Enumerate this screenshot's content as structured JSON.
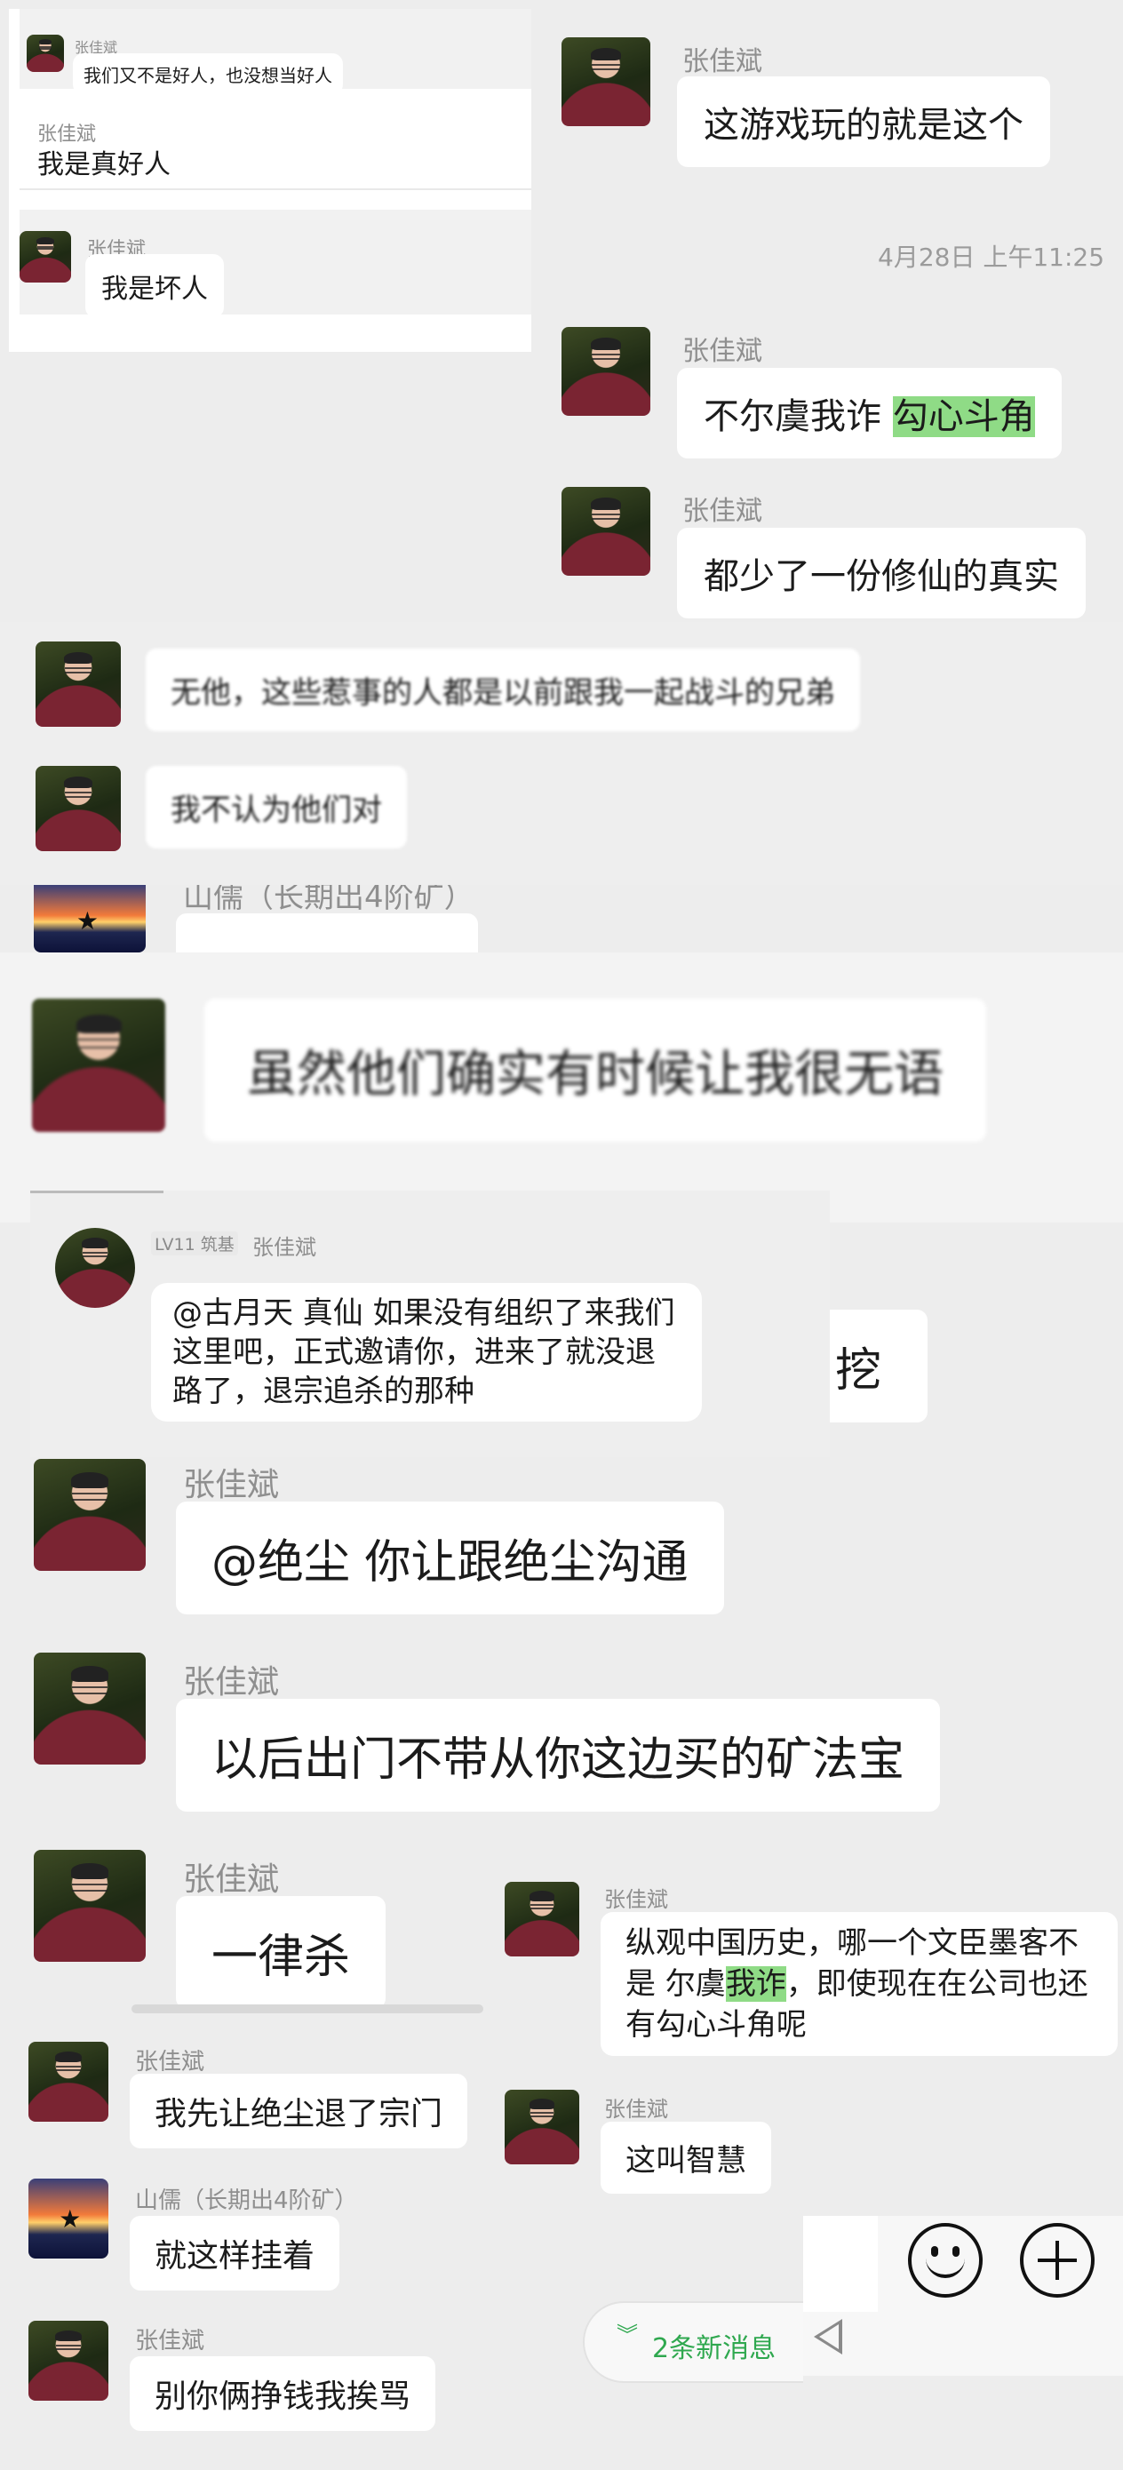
{
  "messages": {
    "p1_m1_name": "张佳斌",
    "p1_m1_text": "我们又不是好人，也没想当好人",
    "p1_m2_name": "张佳斌",
    "p1_m2_text": "我是真好人",
    "p1_m3_name": "张佳斌",
    "p1_m3_text": "我是坏人",
    "p2_m1_name": "张佳斌",
    "p2_m1_text": "这游戏玩的就是这个",
    "p2_time": "4月28日 上午11:25",
    "p2_m2_name": "张佳斌",
    "p2_m2_text_a": "不尔虞我诈 ",
    "p2_m2_text_hl": "勾心斗角",
    "p2_m3_name": "张佳斌",
    "p2_m3_text": "都少了一份修仙的真实",
    "p3_m1_text": "无他，这些惹事的人都是以前跟我一起战斗的兄弟",
    "p3_m2_text": "我不认为他们对",
    "p4_name": "山儒（长期出4阶矿）",
    "p5_text": "虽然他们确实有时候让我很无语",
    "p6_badge": "LV11 筑基",
    "p6_name": "张佳斌",
    "p6_text": "@古月天 真仙 如果没有组织了来我们这里吧，正式邀请你，进来了就没退路了，退宗追杀的那种",
    "p7_partial": "挖",
    "p7_m1_name": "张佳斌",
    "p7_m1_text": "@绝尘  你让跟绝尘沟通",
    "p7_m2_name": "张佳斌",
    "p7_m2_text": "以后出门不带从你这边买的矿法宝",
    "p7_m3_name": "张佳斌",
    "p7_m3_text": "一律杀",
    "p8_name": "张佳斌",
    "p8_text_a": "纵观中国历史，哪一个文臣墨客不是 尔虞",
    "p8_text_hl": "我诈",
    "p8_text_b": "，即使现在在公司也还有勾心斗角呢",
    "p9_m1_name": "张佳斌",
    "p9_m1_text": "我先让绝尘退了宗门",
    "p9_m2_name": "山儒（长期出4阶矿）",
    "p9_m2_text": "就这样挂着",
    "p9_m3_name": "张佳斌",
    "p9_m3_text": "别你俩挣钱我挨骂",
    "p10_name": "张佳斌",
    "p10_text": "这叫智慧",
    "new_messages": "2条新消息"
  },
  "icons": [
    "emoji-icon",
    "plus-icon",
    "back-triangle-icon",
    "double-chevron-down-icon"
  ],
  "colors": {
    "bubble": "#ffffff",
    "background": "#ededed",
    "highlight": "#8fdb86",
    "accent_green": "#2fa84f"
  }
}
